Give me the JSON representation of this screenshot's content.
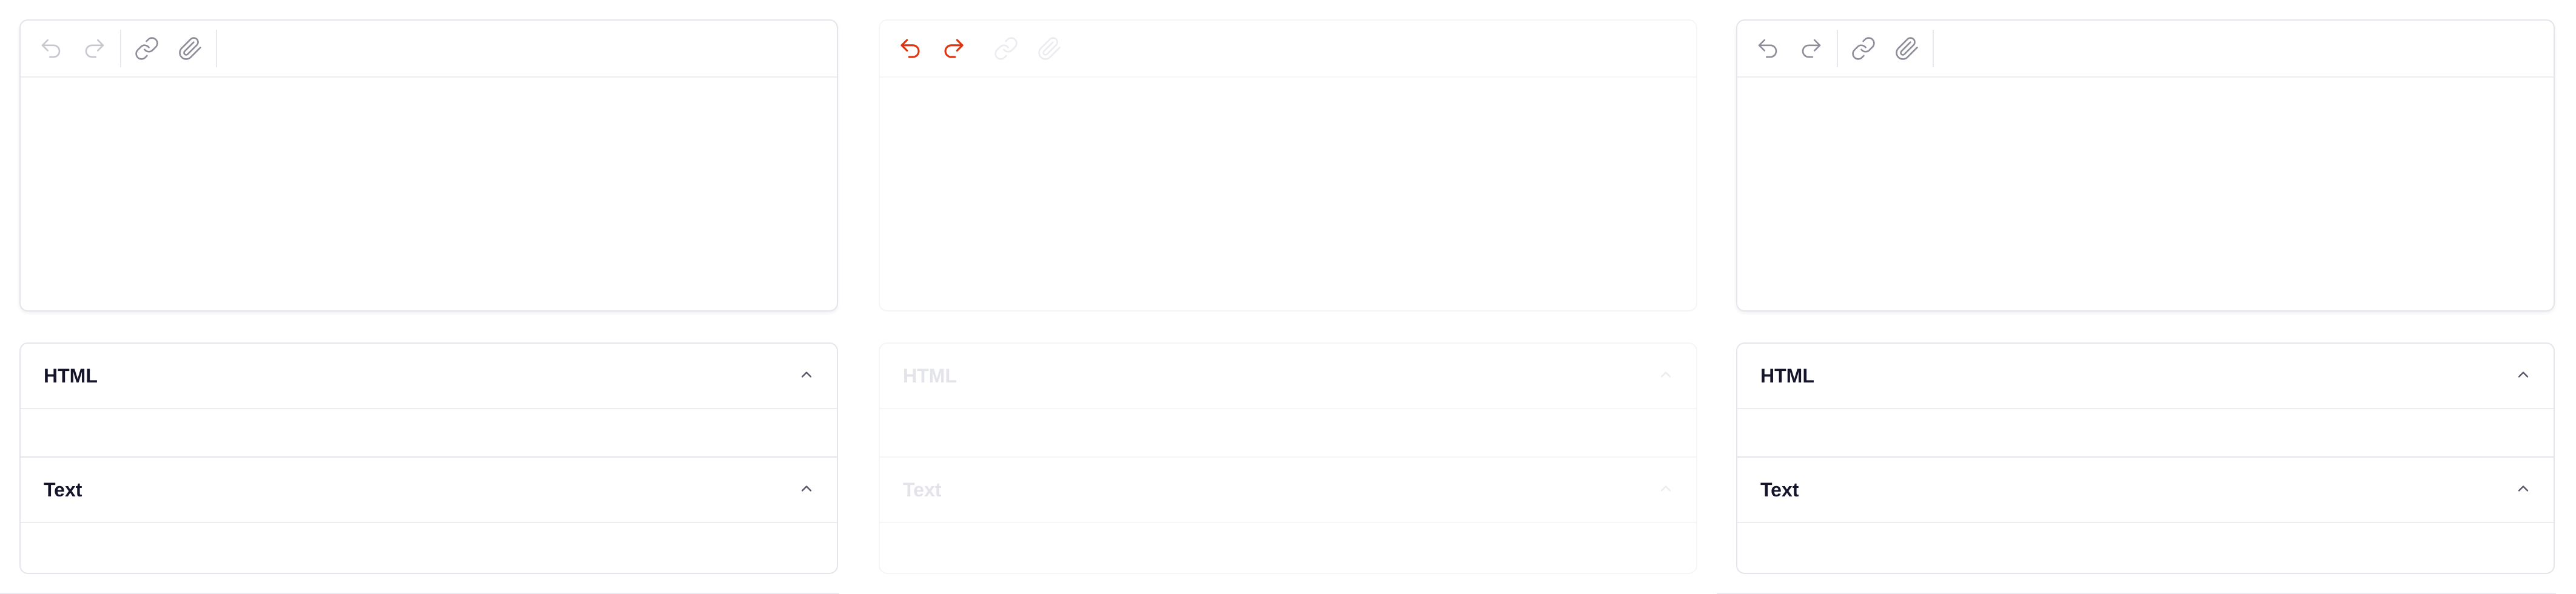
{
  "panels": [
    {
      "state": "default",
      "toolbar": {
        "undo": {
          "icon": "undo-icon",
          "state": "disabled"
        },
        "redo": {
          "icon": "redo-icon",
          "state": "disabled"
        },
        "link": {
          "icon": "link-icon",
          "state": "enabled"
        },
        "attach": {
          "icon": "paperclip-icon",
          "state": "enabled"
        }
      },
      "sections": [
        {
          "title": "HTML",
          "expanded": true
        },
        {
          "title": "Text",
          "expanded": true
        }
      ]
    },
    {
      "state": "disabled",
      "toolbar": {
        "undo": {
          "icon": "undo-icon",
          "state": "accent"
        },
        "redo": {
          "icon": "redo-icon",
          "state": "accent"
        },
        "link": {
          "icon": "link-icon",
          "state": "faint"
        },
        "attach": {
          "icon": "paperclip-icon",
          "state": "faint"
        }
      },
      "sections": [
        {
          "title": "HTML",
          "expanded": true
        },
        {
          "title": "Text",
          "expanded": true
        }
      ]
    },
    {
      "state": "default",
      "toolbar": {
        "undo": {
          "icon": "undo-icon",
          "state": "enabled"
        },
        "redo": {
          "icon": "redo-icon",
          "state": "enabled"
        },
        "link": {
          "icon": "link-icon",
          "state": "enabled"
        },
        "attach": {
          "icon": "paperclip-icon",
          "state": "enabled"
        }
      },
      "sections": [
        {
          "title": "HTML",
          "expanded": true
        },
        {
          "title": "Text",
          "expanded": true
        }
      ]
    }
  ],
  "colors": {
    "accent": "#e0330f",
    "border": "#e4e4ea",
    "icon_disabled": "#c6c6cf",
    "icon_enabled": "#8d8d99",
    "title": "#14142b"
  }
}
